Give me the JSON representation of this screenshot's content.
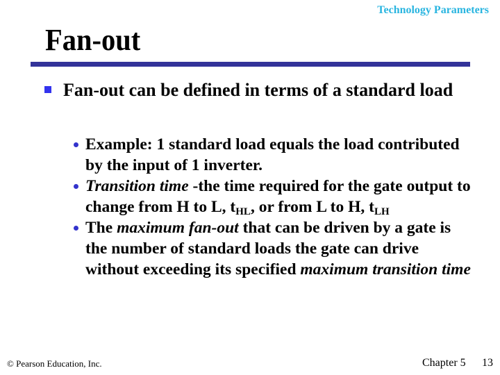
{
  "header": {
    "section_label": "Technology Parameters"
  },
  "title": "Fan-out",
  "colors": {
    "section_label": "#29b5e0",
    "title_rule": "#333399",
    "bullet_square": "#3333ee",
    "bullet_dot": "#3333cc"
  },
  "main_bullet": {
    "icon": "square-bullet-icon",
    "text": "Fan-out can be defined in terms of a standard load"
  },
  "sub_bullets": [
    {
      "icon": "dot-bullet-icon",
      "text": "Example: 1 standard load equals the load contributed by the input of 1 inverter."
    },
    {
      "icon": "dot-bullet-icon",
      "term": "Transition time",
      "text_a": " -the time required for the gate output to change from H to L, t",
      "sub_a": "HL",
      "text_b": ", or from L to H, t",
      "sub_b": "LH"
    },
    {
      "icon": "dot-bullet-icon",
      "text_a": "The ",
      "term_a": "maximum fan-out",
      "text_b": " that can be driven by a gate is the number of standard loads the gate can drive without exceeding its specified ",
      "term_b": "maximum transition time"
    }
  ],
  "footer": {
    "copyright": "© Pearson Education, Inc.",
    "chapter": "Chapter 5",
    "page": "13"
  }
}
